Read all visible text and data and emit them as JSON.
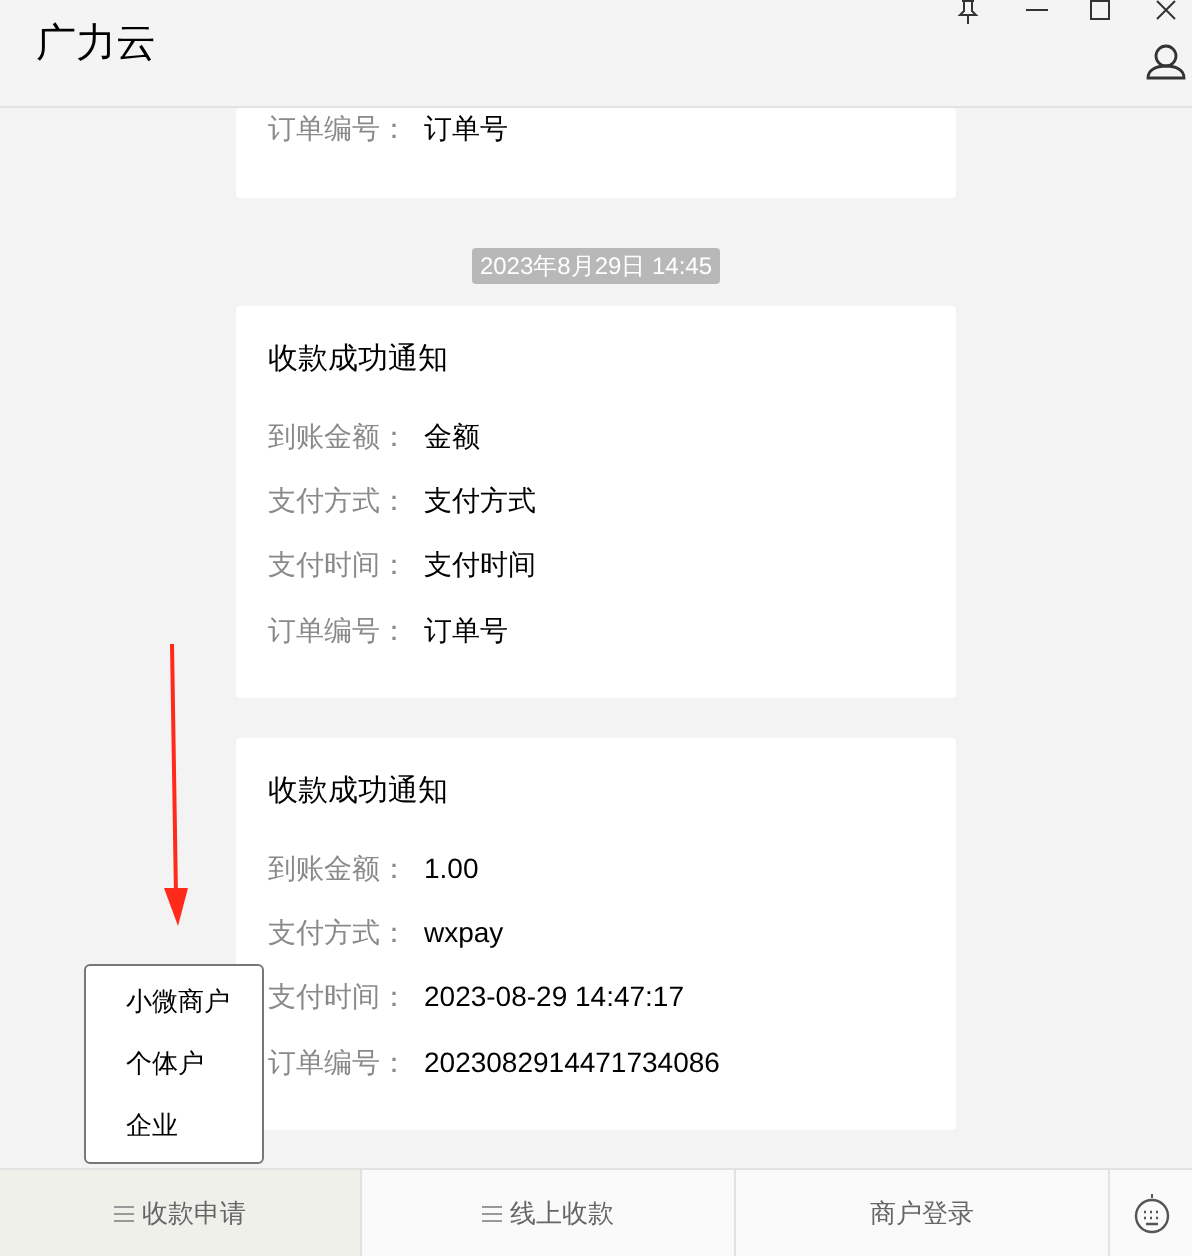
{
  "window": {
    "title": "广力云"
  },
  "messages": [
    {
      "kind": "card",
      "rows": [
        {
          "label": "订单编号：",
          "value": "订单号"
        }
      ]
    },
    {
      "kind": "time",
      "text": "2023年8月29日 14:45"
    },
    {
      "kind": "card",
      "title": "收款成功通知",
      "rows": [
        {
          "label": "到账金额：",
          "value": "金额"
        },
        {
          "label": "支付方式：",
          "value": "支付方式"
        },
        {
          "label": "支付时间：",
          "value": "支付时间"
        },
        {
          "label": "订单编号：",
          "value": "订单号"
        }
      ]
    },
    {
      "kind": "card",
      "title": "收款成功通知",
      "rows": [
        {
          "label": "到账金额：",
          "value": "1.00"
        },
        {
          "label": "支付方式：",
          "value": "wxpay"
        },
        {
          "label": "支付时间：",
          "value": "2023-08-29 14:47:17"
        },
        {
          "label": "订单编号：",
          "value": "2023082914471734086"
        }
      ]
    }
  ],
  "popup_menu": {
    "items": [
      "小微商户",
      "个体户",
      "企业"
    ]
  },
  "bottom_tabs": [
    {
      "label": "收款申请",
      "kind": "menu",
      "selected": true
    },
    {
      "label": "线上收款",
      "kind": "menu",
      "selected": false
    },
    {
      "label": "商户登录",
      "kind": "link",
      "selected": false
    }
  ]
}
